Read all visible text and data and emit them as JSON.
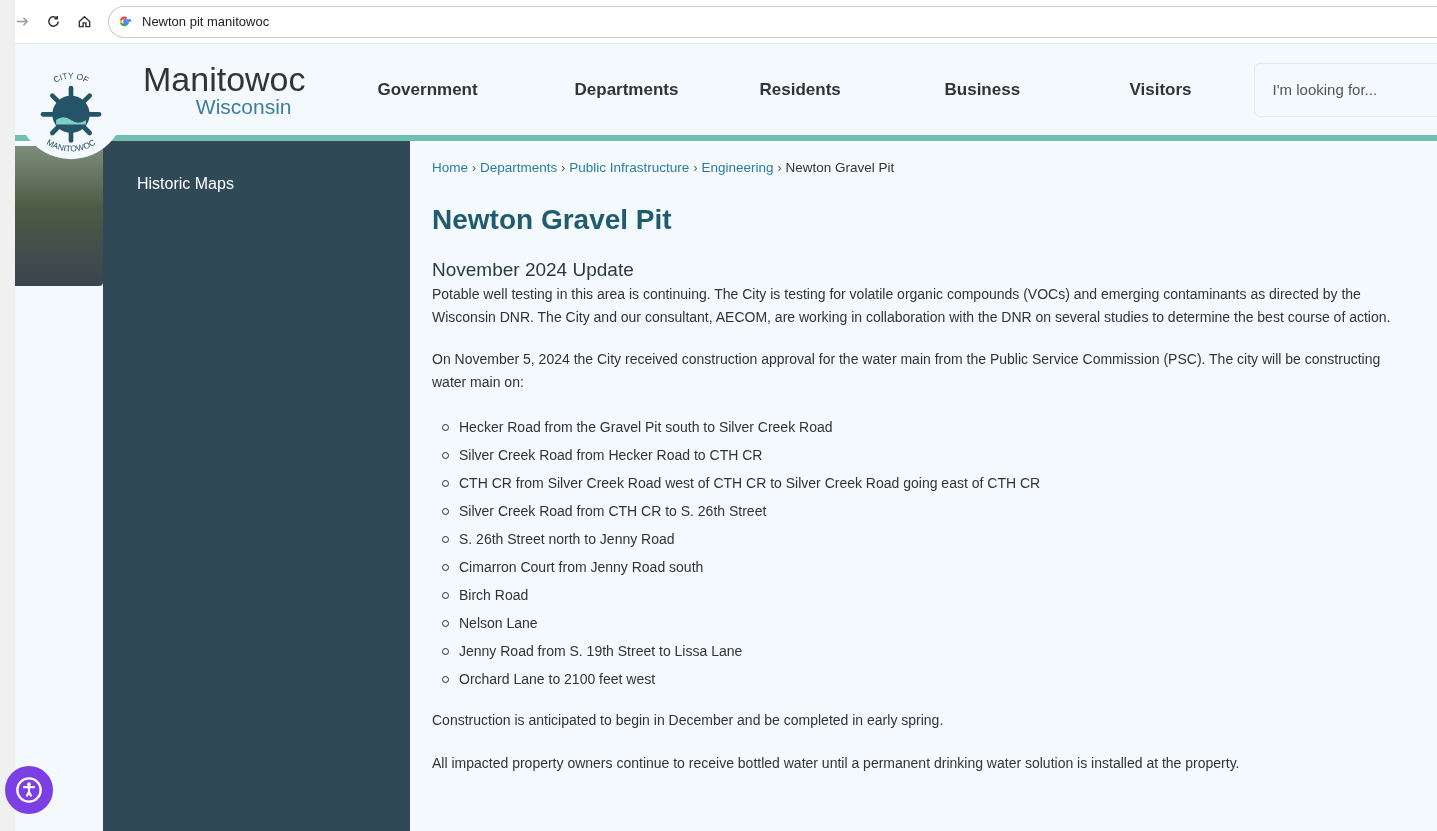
{
  "browser": {
    "address": "Newton pit manitowoc"
  },
  "header": {
    "logo_top": "CITY OF",
    "logo_bottom": "MANITOWOC",
    "title": "Manitowoc",
    "subtitle": "Wisconsin",
    "nav": [
      "Government",
      "Departments",
      "Residents",
      "Business",
      "Visitors"
    ],
    "search": {
      "placeholder": "I'm looking for..."
    }
  },
  "sidebar": {
    "items": [
      "Historic Maps"
    ]
  },
  "breadcrumb": {
    "separator": "›",
    "links": [
      "Home",
      "Departments",
      "Public Infrastructure",
      "Engineering"
    ],
    "current": "Newton Gravel Pit"
  },
  "page": {
    "title": "Newton Gravel Pit",
    "section_heading": "November 2024 Update",
    "paragraphs_before": [
      "Potable well testing in this area is continuing. The City is testing for volatile organic compounds (VOCs) and emerging contaminants as directed by the Wisconsin DNR. The City and our consultant, AECOM, are working in collaboration with the DNR on several studies to determine the best course of action.",
      "On November 5, 2024 the City received construction approval for the water main from the Public Service Commission (PSC).  The city will be constructing water main on:"
    ],
    "list": [
      "Hecker Road from the Gravel Pit south to Silver Creek Road",
      "Silver Creek Road from Hecker Road to CTH CR",
      "CTH CR from Silver Creek Road west of CTH CR to Silver Creek Road going east of CTH CR",
      "Silver Creek Road from CTH CR to S. 26th Street",
      "S. 26th Street north to Jenny Road",
      "Cimarron Court from Jenny Road south",
      "Birch Road",
      "Nelson Lane",
      "Jenny Road from S. 19th Street to Lissa Lane",
      "Orchard Lane to 2100 feet west"
    ],
    "paragraphs_after": [
      "Construction is anticipated to begin in December and be completed in early spring.",
      "All impacted property owners continue to receive bottled water until a permanent drinking water solution is installed at the property."
    ]
  }
}
